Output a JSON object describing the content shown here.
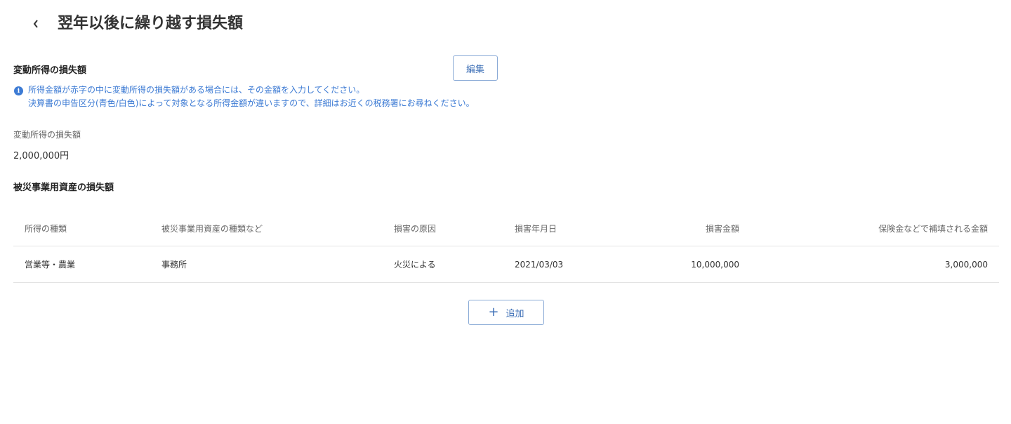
{
  "header": {
    "title": "翌年以後に繰り越す損失額",
    "back_icon": "chevron-left-icon"
  },
  "variable_income_section": {
    "title": "変動所得の損失額",
    "edit_label": "編集",
    "info_icon": "info-icon",
    "info_lines": [
      "所得金額が赤字の中に変動所得の損失額がある場合には、その金額を入力してください。",
      "決算書の申告区分(青色/白色)によって対象となる所得金額が違いますので、詳細はお近くの税務署にお尋ねください。"
    ],
    "field_label": "変動所得の損失額",
    "field_value": "2,000,000円"
  },
  "disaster_section": {
    "title": "被災事業用資産の損失額",
    "columns": [
      "所得の種類",
      "被災事業用資産の種類など",
      "損害の原因",
      "損害年月日",
      "損害金額",
      "保険金などで補填される金額"
    ],
    "rows": [
      [
        "営業等・農業",
        "事務所",
        "火災による",
        "2021/03/03",
        "10,000,000",
        "3,000,000"
      ]
    ],
    "add_label": "追加",
    "add_icon": "plus-icon"
  },
  "colors": {
    "accent": "#3d7bd4",
    "button_border": "#8aaad6",
    "divider": "#e3e3e3"
  }
}
